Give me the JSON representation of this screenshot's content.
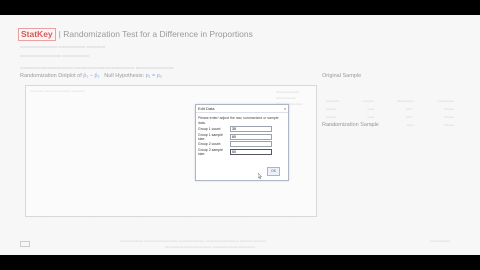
{
  "app": {
    "logo": "StatKey",
    "title": "Randomization Test for a Difference in Proportions",
    "title_separator": "|"
  },
  "plot": {
    "heading_start": "Randomization Dotplot of",
    "heading_stat": "p̂₁ − p̂₂",
    "heading_null": "Null Hypothesis:",
    "heading_null_value": "p₁ = p₂"
  },
  "right": {
    "original_sample": "Original Sample",
    "randomization_sample": "Randomization Sample"
  },
  "dialog": {
    "title": "Edit Data",
    "close": "x",
    "message": "Please enter/ adjust the raw, summarized or sample data.",
    "fields": [
      {
        "label": "Group 1 count:",
        "value": "35"
      },
      {
        "label": "Group 1 sample size:",
        "value": "60"
      },
      {
        "label": "Group 2 count:",
        "value": ""
      },
      {
        "label": "Group 2 sample size:",
        "value": "50"
      }
    ],
    "ok": "OK"
  }
}
